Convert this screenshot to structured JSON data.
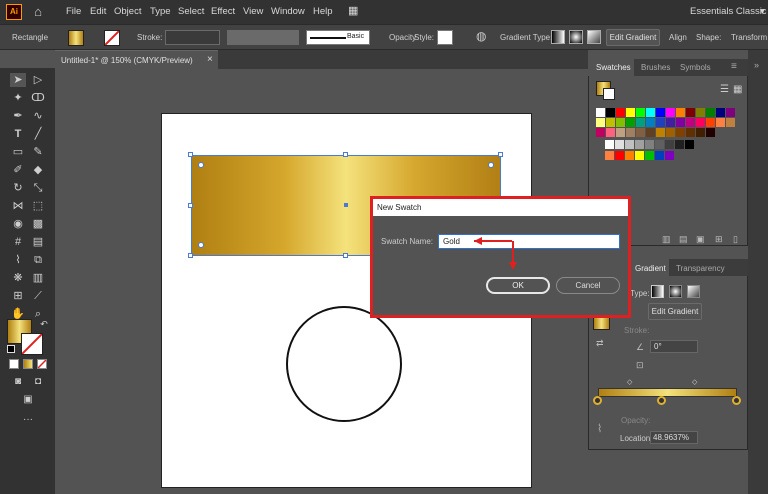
{
  "menubar": {
    "logo_text": "Ai",
    "items": [
      "File",
      "Edit",
      "Object",
      "Type",
      "Select",
      "Effect",
      "View",
      "Window",
      "Help"
    ],
    "workspace": "Essentials Classic"
  },
  "control_bar": {
    "tool_name": "Rectangle",
    "stroke_label": "Stroke:",
    "brush_label": "Basic",
    "opacity_label": "Opacity",
    "style_label": "Style:",
    "gradient_type_label": "Gradient Type:",
    "edit_gradient": "Edit Gradient",
    "align": "Align",
    "shape": "Shape:",
    "transform": "Transform"
  },
  "document": {
    "tab_title": "Untitled-1* @ 150% (CMYK/Preview)",
    "close": "×"
  },
  "dialog": {
    "title": "New Swatch",
    "swatch_name_label": "Swatch Name:",
    "swatch_name_value": "Gold",
    "ok": "OK",
    "cancel": "Cancel"
  },
  "swatches_panel": {
    "tabs": [
      "Swatches",
      "Brushes",
      "Symbols"
    ],
    "rows": [
      [
        "#ffffff",
        "#000000",
        "#ff0000",
        "#ffff00",
        "#00ff00",
        "#00ffff",
        "#0000ff",
        "#ff00ff",
        "#ff8000",
        "#7f0000",
        "#7f7f00",
        "#007f00",
        "#00007f",
        "#7f007f"
      ],
      [
        "#ffff80",
        "#c0c000",
        "#80c000",
        "#00a000",
        "#00a080",
        "#0080c0",
        "#2040c0",
        "#4020a0",
        "#8000a0",
        "#c00080",
        "#ff0060",
        "#ff4000",
        "#ff8040",
        "#c08040"
      ],
      [
        "#c00060",
        "#ff6080",
        "#c0a080",
        "#a08060",
        "#806040",
        "#604020",
        "#c08000",
        "#a06000",
        "#804000",
        "#603000",
        "#402000",
        "#200000"
      ],
      [
        "#ffffff",
        "#e0e0e0",
        "#c0c0c0",
        "#a0a0a0",
        "#808080",
        "#606060",
        "#404040",
        "#202020",
        "#000000"
      ],
      [
        "#ff8040",
        "#ff0000",
        "#ff8000",
        "#ffff00",
        "#00c000",
        "#0040c0",
        "#8000c0"
      ]
    ]
  },
  "gradient_panel": {
    "tabs": [
      "Gradient",
      "Transparency"
    ],
    "type_label": "Type:",
    "edit_gradient": "Edit Gradient",
    "stroke_label": "Stroke:",
    "angle": "0°",
    "opacity_label": "Opacity:",
    "location_label": "Location:",
    "location_value": "48.9637%"
  },
  "colors": {
    "gold_dark": "#b07f12",
    "gold_light": "#f4e27c",
    "highlight": "#e02020"
  }
}
